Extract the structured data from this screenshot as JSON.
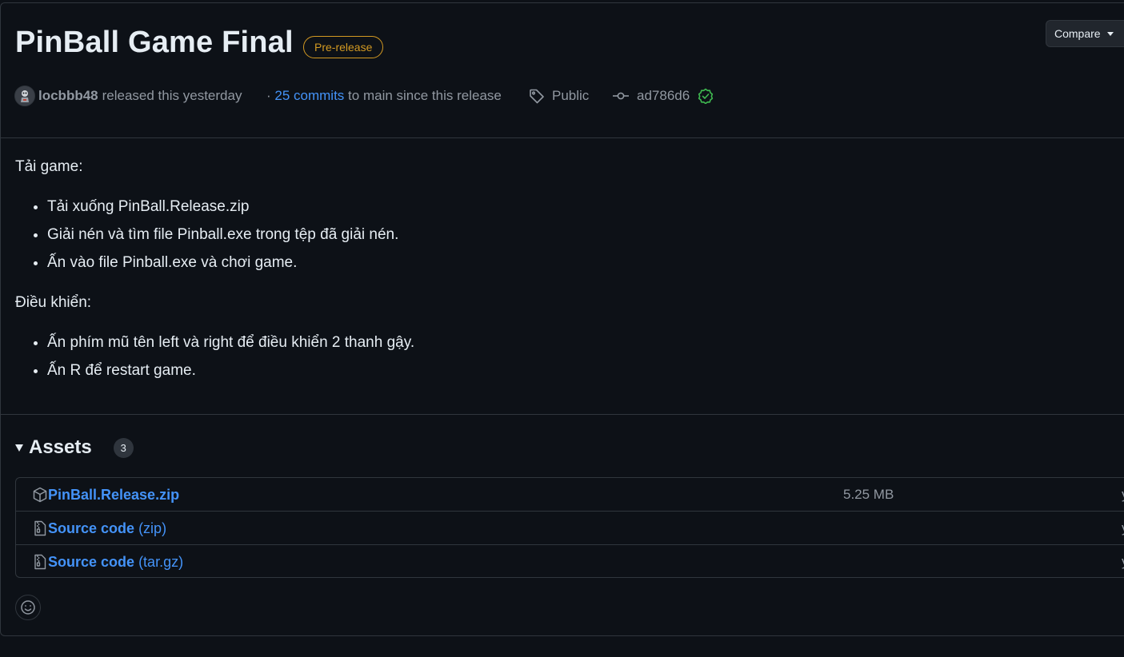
{
  "release": {
    "title": "PinBall Game Final",
    "badge": "Pre-release",
    "compare_label": "Compare",
    "author": "locbbb48",
    "released_text": "released this yesterday",
    "commits_link": "25 commits",
    "commits_suffix": "to main since this release",
    "tag_label": "Public",
    "commit_hash": "ad786d6"
  },
  "notes": {
    "heading1": "Tải game:",
    "list1": [
      "Tải xuống PinBall.Release.zip",
      "Giải nén và tìm file Pinball.exe trong tệp đã giải nén.",
      "Ấn vào file Pinball.exe và chơi game."
    ],
    "heading2": "Điều khiển:",
    "list2": [
      "Ấn phím mũ tên left và right để điều khiển 2 thanh gậy.",
      "Ấn R để restart game."
    ]
  },
  "assets": {
    "title": "Assets",
    "count": "3",
    "items": [
      {
        "name": "PinBall.Release.zip",
        "suffix": "",
        "size": "5.25 MB",
        "cut": "y"
      },
      {
        "name": "Source code",
        "suffix": "(zip)",
        "size": "",
        "cut": "y"
      },
      {
        "name": "Source code",
        "suffix": "(tar.gz)",
        "size": "",
        "cut": "y"
      }
    ]
  },
  "colors": {
    "background": "#0d1117",
    "border": "#30363d",
    "link": "#4493f8",
    "prerelease": "#d29922",
    "verified": "#3fb950",
    "muted": "#9198a1"
  },
  "icons": [
    "avatar",
    "tag-icon",
    "commit-icon",
    "verified-icon",
    "package-icon",
    "file-zip-icon",
    "triangle-down-icon",
    "smiley-icon",
    "caret-down-icon"
  ]
}
